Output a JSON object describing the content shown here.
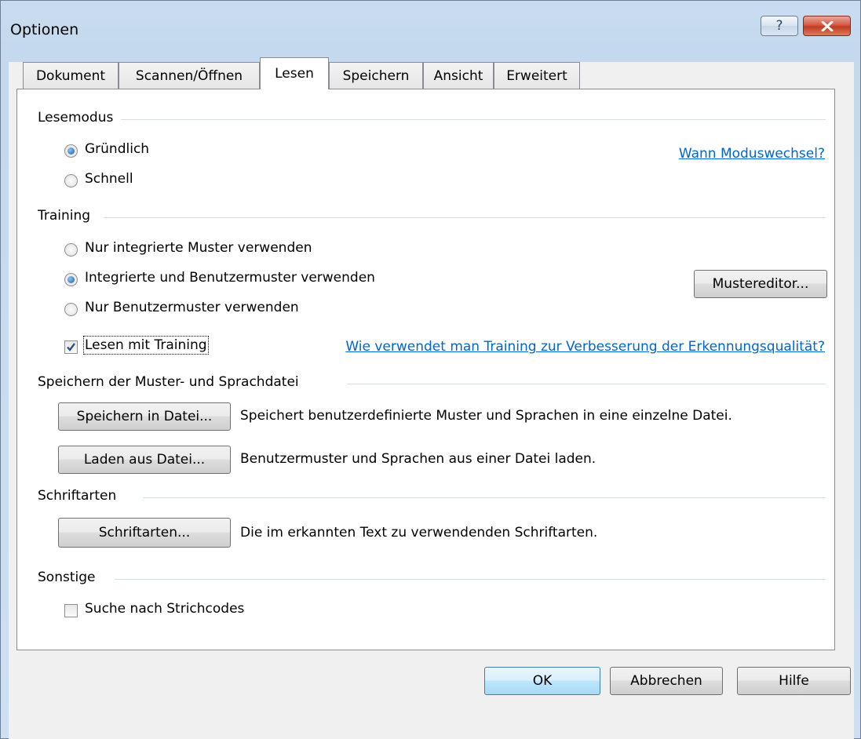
{
  "window": {
    "title": "Optionen",
    "help_button": "?"
  },
  "tabs": [
    {
      "label": "Dokument"
    },
    {
      "label": "Scannen/Öffnen"
    },
    {
      "label": "Lesen",
      "active": true
    },
    {
      "label": "Speichern"
    },
    {
      "label": "Ansicht"
    },
    {
      "label": "Erweitert"
    }
  ],
  "lesemodus": {
    "title": "Lesemodus",
    "options": [
      {
        "label": "Gründlich",
        "selected": true
      },
      {
        "label": "Schnell",
        "selected": false
      }
    ],
    "help_link": "Wann Moduswechsel?"
  },
  "training": {
    "title": "Training",
    "options": [
      {
        "label": "Nur integrierte Muster verwenden",
        "selected": false
      },
      {
        "label": "Integrierte und Benutzermuster verwenden",
        "selected": true
      },
      {
        "label": "Nur Benutzermuster verwenden",
        "selected": false
      }
    ],
    "editor_button": "Mustereditor...",
    "checkbox_label": "Lesen mit Training",
    "checkbox_checked": true,
    "help_link": "Wie verwendet man Training zur Verbesserung der Erkennungsqualität?"
  },
  "muster_datei": {
    "title": "Speichern der Muster- und Sprachdatei",
    "save_button": "Speichern in Datei...",
    "save_desc": "Speichert benutzerdefinierte Muster und Sprachen in eine einzelne Datei.",
    "load_button": "Laden aus Datei...",
    "load_desc": "Benutzermuster und Sprachen aus einer Datei laden."
  },
  "schriftarten": {
    "title": "Schriftarten",
    "button": "Schriftarten...",
    "desc": "Die im erkannten Text zu verwendenden Schriftarten."
  },
  "sonstige": {
    "title": "Sonstige",
    "barcode_label": "Suche nach Strichcodes",
    "barcode_checked": false
  },
  "footer": {
    "ok": "OK",
    "cancel": "Abbrechen",
    "help": "Hilfe"
  }
}
